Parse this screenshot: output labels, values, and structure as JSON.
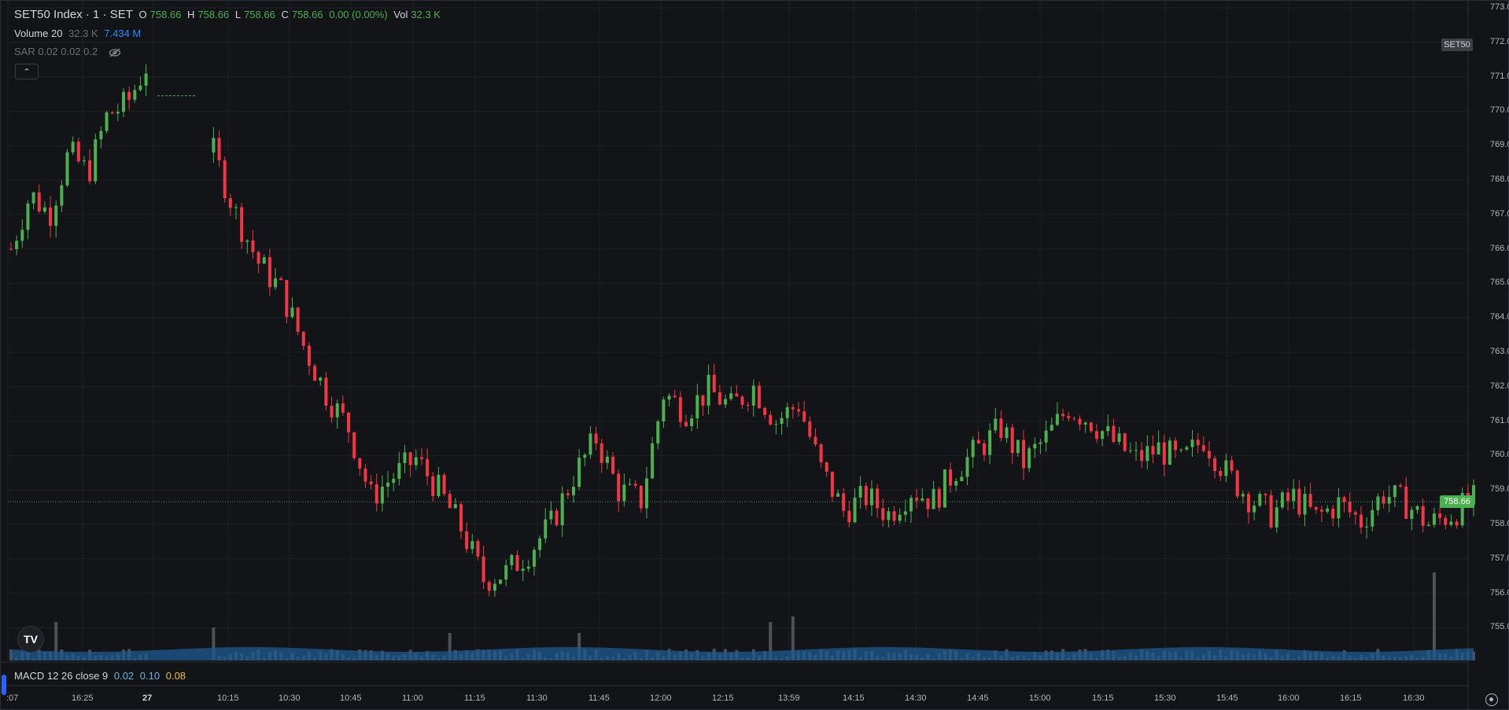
{
  "legend": {
    "title": "SET50 Index · 1 · SET",
    "o_key": "O",
    "o_val": "758.66",
    "h_key": "H",
    "h_val": "758.66",
    "l_key": "L",
    "l_val": "758.66",
    "c_key": "C",
    "c_val": "758.66",
    "change": "0.00 (0.00%)",
    "vol_key": "Vol",
    "vol_val": "32.3 K",
    "volume_label": "Volume 20",
    "volume_val": "32.3 K",
    "volume_ma": "7.434 M",
    "sar_label": "SAR 0.02 0.02 0.2",
    "macd_label": "MACD 12 26 close 9",
    "macd_v1": "0.02",
    "macd_v2": "0.10",
    "macd_v3": "0.08"
  },
  "symbol_tag": "SET50",
  "last_price_tag": "758.66",
  "logo_text": "TV",
  "colors": {
    "up": "#4caf50",
    "down": "#f23645",
    "volume": "#5d6068",
    "volume_ma": "#1f5a8f",
    "background": "#131417"
  },
  "icons": {
    "collapse": "chevron-up-icon",
    "hide": "eye-off-icon",
    "settings": "gear-icon",
    "logo": "tradingview-logo-icon"
  },
  "chart_data": {
    "type": "candlestick",
    "ylim": [
      754.2,
      773.0
    ],
    "y_ticks": [
      "773.00",
      "772.00",
      "771.00",
      "770.00",
      "769.00",
      "768.00",
      "767.00",
      "766.00",
      "765.00",
      "764.00",
      "763.00",
      "762.00",
      "761.00",
      "760.00",
      "759.00",
      "758.00",
      "757.00",
      "756.00",
      "755.00"
    ],
    "x_ticks": [
      ":07",
      "16:25",
      "27",
      "10:15",
      "10:30",
      "10:45",
      "11:00",
      "11:15",
      "11:30",
      "11:45",
      "12:00",
      "12:15",
      "13:59",
      "14:15",
      "14:30",
      "14:45",
      "15:00",
      "15:15",
      "15:30",
      "15:45",
      "16:00",
      "16:15",
      "16:30"
    ],
    "last_price": 758.66,
    "segments": [
      {
        "start": 0,
        "count": 25,
        "path": [
          766.0,
          767.6,
          767.0,
          768.8,
          768.2,
          769.9,
          770.2,
          771.3
        ]
      },
      {
        "start": 36,
        "count": 225,
        "path": [
          768.8,
          767.0,
          765.6,
          764.8,
          763.2,
          761.8,
          760.8,
          758.8,
          759.4,
          759.9,
          759.0,
          757.9,
          756.4,
          756.6,
          757.2,
          758.0,
          759.4,
          760.5,
          759.0,
          758.7,
          761.8,
          761.3,
          761.9,
          761.4,
          762.0,
          761.0,
          761.5,
          759.6,
          758.4,
          758.8,
          758.3,
          759.0,
          758.7,
          759.6,
          760.2,
          760.8,
          759.8,
          760.5,
          761.4,
          761.0,
          760.4,
          759.9,
          760.2,
          759.8,
          760.5,
          759.5,
          758.8,
          758.3,
          758.8,
          758.2,
          758.6,
          758.1,
          758.9,
          758.6,
          758.0,
          758.3,
          758.7
        ]
      }
    ],
    "volume_baseline_label": "Volume 20",
    "volume_spikes": [
      {
        "index": 8,
        "value": 0.35
      },
      {
        "index": 25,
        "value": 0.7
      },
      {
        "index": 36,
        "value": 0.3
      },
      {
        "index": 78,
        "value": 0.25
      },
      {
        "index": 101,
        "value": 0.25
      },
      {
        "index": 135,
        "value": 0.35
      },
      {
        "index": 139,
        "value": 0.4
      },
      {
        "index": 253,
        "value": 0.8
      }
    ]
  }
}
